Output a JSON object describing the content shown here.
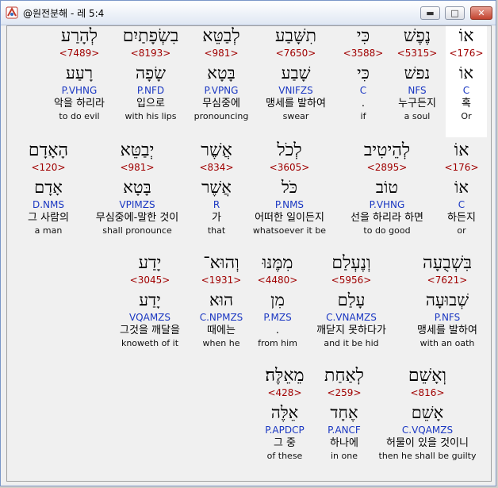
{
  "window": {
    "title": "@원전분해 - 레 5:4",
    "buttons": {
      "minimize": "▬",
      "maximize": "□",
      "close": "✕"
    }
  },
  "colors": {
    "strong": "#a00000",
    "morph": "#1a37c2",
    "highlight": "#ffffff"
  },
  "rows": [
    {
      "words": [
        {
          "heb": "אוֹ",
          "strong": "<176>",
          "lex": "אוֹ",
          "morph": "C",
          "kor": "혹",
          "eng": "Or",
          "highlight": true
        },
        {
          "heb": "נֶפֶשׁ",
          "strong": "<5315>",
          "lex": "נפשׁ",
          "morph": "NFS",
          "kor": "누구든지",
          "eng": "a soul"
        },
        {
          "heb": "כִּי",
          "strong": "<3588>",
          "lex": "כִּי",
          "morph": "C",
          "kor": ".",
          "eng": "if"
        },
        {
          "heb": "תִשָּׁבַע",
          "strong": "<7650>",
          "lex": "שָׁבַע",
          "morph": "VNIFZS",
          "kor": "맹세를 발하여",
          "eng": "swear"
        },
        {
          "heb": "לְבַטֵּא",
          "strong": "<981>",
          "lex": "בָּטָא",
          "morph": "P.VPNG",
          "kor": "무심중에",
          "eng": "pronouncing"
        },
        {
          "heb": "בִשְׂפָתַיִם",
          "strong": "<8193>",
          "lex": "שָׂפָה",
          "morph": "P.NFD",
          "kor": "입으로",
          "eng": "with his lips"
        },
        {
          "heb": "לְהָרַע",
          "strong": "<7489>",
          "lex": "רָעַע",
          "morph": "P.VHNG",
          "kor": "악을 하리라",
          "eng": "to do evil"
        }
      ]
    },
    {
      "words": [
        {
          "heb": "אוֹ",
          "strong": "<176>",
          "lex": "אוֹ",
          "morph": "C",
          "kor": "하든지",
          "eng": "or"
        },
        {
          "heb": "לְהֵיטִיב",
          "strong": "<2895>",
          "lex": "טוֹב",
          "morph": "P.VHNG",
          "kor": "선을 하리라 하면",
          "eng": "to do good"
        },
        {
          "heb": "לְכֹל",
          "strong": "<3605>",
          "lex": "כֹּל",
          "morph": "P.NMS",
          "kor": "어떠한 일이든지",
          "eng": "whatsoever it be"
        },
        {
          "heb": "אֲשֶׁר",
          "strong": "<834>",
          "lex": "אֲשֶׁר",
          "morph": "R",
          "kor": "가",
          "eng": "that"
        },
        {
          "heb": "יְבַטֵּא",
          "strong": "<981>",
          "lex": "בָּטָא",
          "morph": "VPIMZS",
          "kor": "무심중에-말한 것이",
          "eng": "shall pronounce"
        },
        {
          "heb": "הָאָדָם",
          "strong": "<120>",
          "lex": "אָדָם",
          "morph": "D.NMS",
          "kor": "그 사람의",
          "eng": "a man"
        }
      ]
    },
    {
      "words": [
        {
          "heb": "בִּשְׁבֻעָה",
          "strong": "<7621>",
          "lex": "שְׁבוּעָה",
          "morph": "P.NFS",
          "kor": "맹세를 발하여",
          "eng": "with an oath"
        },
        {
          "heb": "וְנֶעְלַם",
          "strong": "<5956>",
          "lex": "עָלַם",
          "morph": "C.VNAMZS",
          "kor": "깨닫지 못하다가",
          "eng": "and it be hid"
        },
        {
          "heb": "מִמֶּנּוּ",
          "strong": "<4480>",
          "lex": "מִן",
          "morph": "P.MZS",
          "kor": ".",
          "eng": "from him"
        },
        {
          "heb": "וְהוּא־",
          "strong": "<1931>",
          "lex": "הוּא",
          "morph": "C.NPMZS",
          "kor": "때에는",
          "eng": "when he"
        },
        {
          "heb": "יָדַע",
          "strong": "<3045>",
          "lex": "יָדַע",
          "morph": "VQAMZS",
          "kor": "그것을 깨달을",
          "eng": "knoweth of it"
        }
      ]
    },
    {
      "words": [
        {
          "heb": "וְאָשֵׁם",
          "strong": "<816>",
          "lex": "אָשֵׁם",
          "morph": "C.VQAMZS",
          "kor": "허물이 있을 것이니",
          "eng": "then he shall be guilty"
        },
        {
          "heb": "לְאַחַת",
          "strong": "<259>",
          "lex": "אֶחָד",
          "morph": "P.ANCF",
          "kor": "하나에",
          "eng": "in one"
        },
        {
          "heb": "מֵאֵלֶּה׃",
          "strong": "<428>",
          "lex": "אֵלֶּה",
          "morph": "P.APDCP",
          "kor": "그 중",
          "eng": "of these"
        }
      ]
    }
  ]
}
